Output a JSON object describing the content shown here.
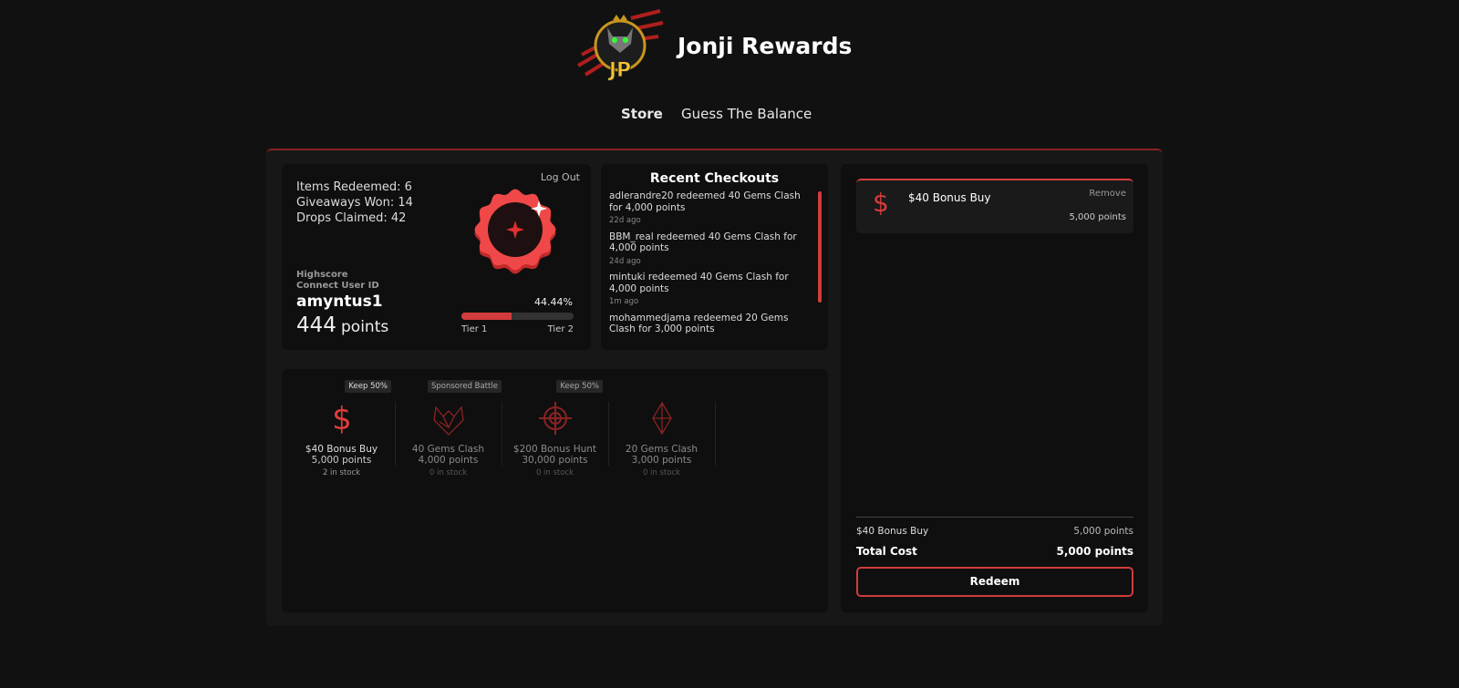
{
  "header": {
    "title": "Jonji Rewards",
    "logo_text": "JP"
  },
  "nav": [
    {
      "label": "Store",
      "active": true
    },
    {
      "label": "Guess The Balance",
      "active": false
    }
  ],
  "profile": {
    "logout": "Log Out",
    "items_redeemed": "Items Redeemed: 6",
    "giveaways_won": "Giveaways Won: 14",
    "drops_claimed": "Drops Claimed: 42",
    "highscore": "Highscore",
    "connect_label": "Connect User ID",
    "username": "amyntus1",
    "points_value": "444",
    "points_unit": "points",
    "progress_label": "44.44%",
    "progress": 44.44,
    "tier_from": "Tier 1",
    "tier_to": "Tier 2",
    "accent": "#e03c3c"
  },
  "checkouts": {
    "title": "Recent Checkouts",
    "items": [
      {
        "text": "adlerandre20 redeemed 40 Gems Clash for 4,000 points",
        "time": "22d ago"
      },
      {
        "text": "BBM_real redeemed 40 Gems Clash for 4,000 points",
        "time": "24d ago"
      },
      {
        "text": "mintuki redeemed 40 Gems Clash for 4,000 points",
        "time": "1m ago"
      },
      {
        "text": "mohammedjama redeemed 20 Gems Clash for 3,000 points",
        "time": ""
      }
    ]
  },
  "products": [
    {
      "badge": "Keep 50%",
      "name": "$40 Bonus Buy",
      "points": "5,000 points",
      "stock": "2 in stock",
      "icon": "dollar-icon"
    },
    {
      "badge": "Sponsored Battle",
      "name": "40 Gems Clash",
      "points": "4,000 points",
      "stock": "0 in stock",
      "icon": "fox-icon"
    },
    {
      "badge": "Keep 50%",
      "name": "$200 Bonus Hunt",
      "points": "30,000 points",
      "stock": "0 in stock",
      "icon": "target-icon"
    },
    {
      "badge": "",
      "name": "20 Gems Clash",
      "points": "3,000 points",
      "stock": "0 in stock",
      "icon": "gem-icon"
    }
  ],
  "cart": {
    "item": {
      "name": "$40 Bonus Buy",
      "remove": "Remove",
      "points": "5,000 points"
    },
    "summary_name": "$40 Bonus Buy",
    "summary_points": "5,000 points",
    "total_label": "Total Cost",
    "total_value": "5,000 points",
    "redeem": "Redeem"
  }
}
